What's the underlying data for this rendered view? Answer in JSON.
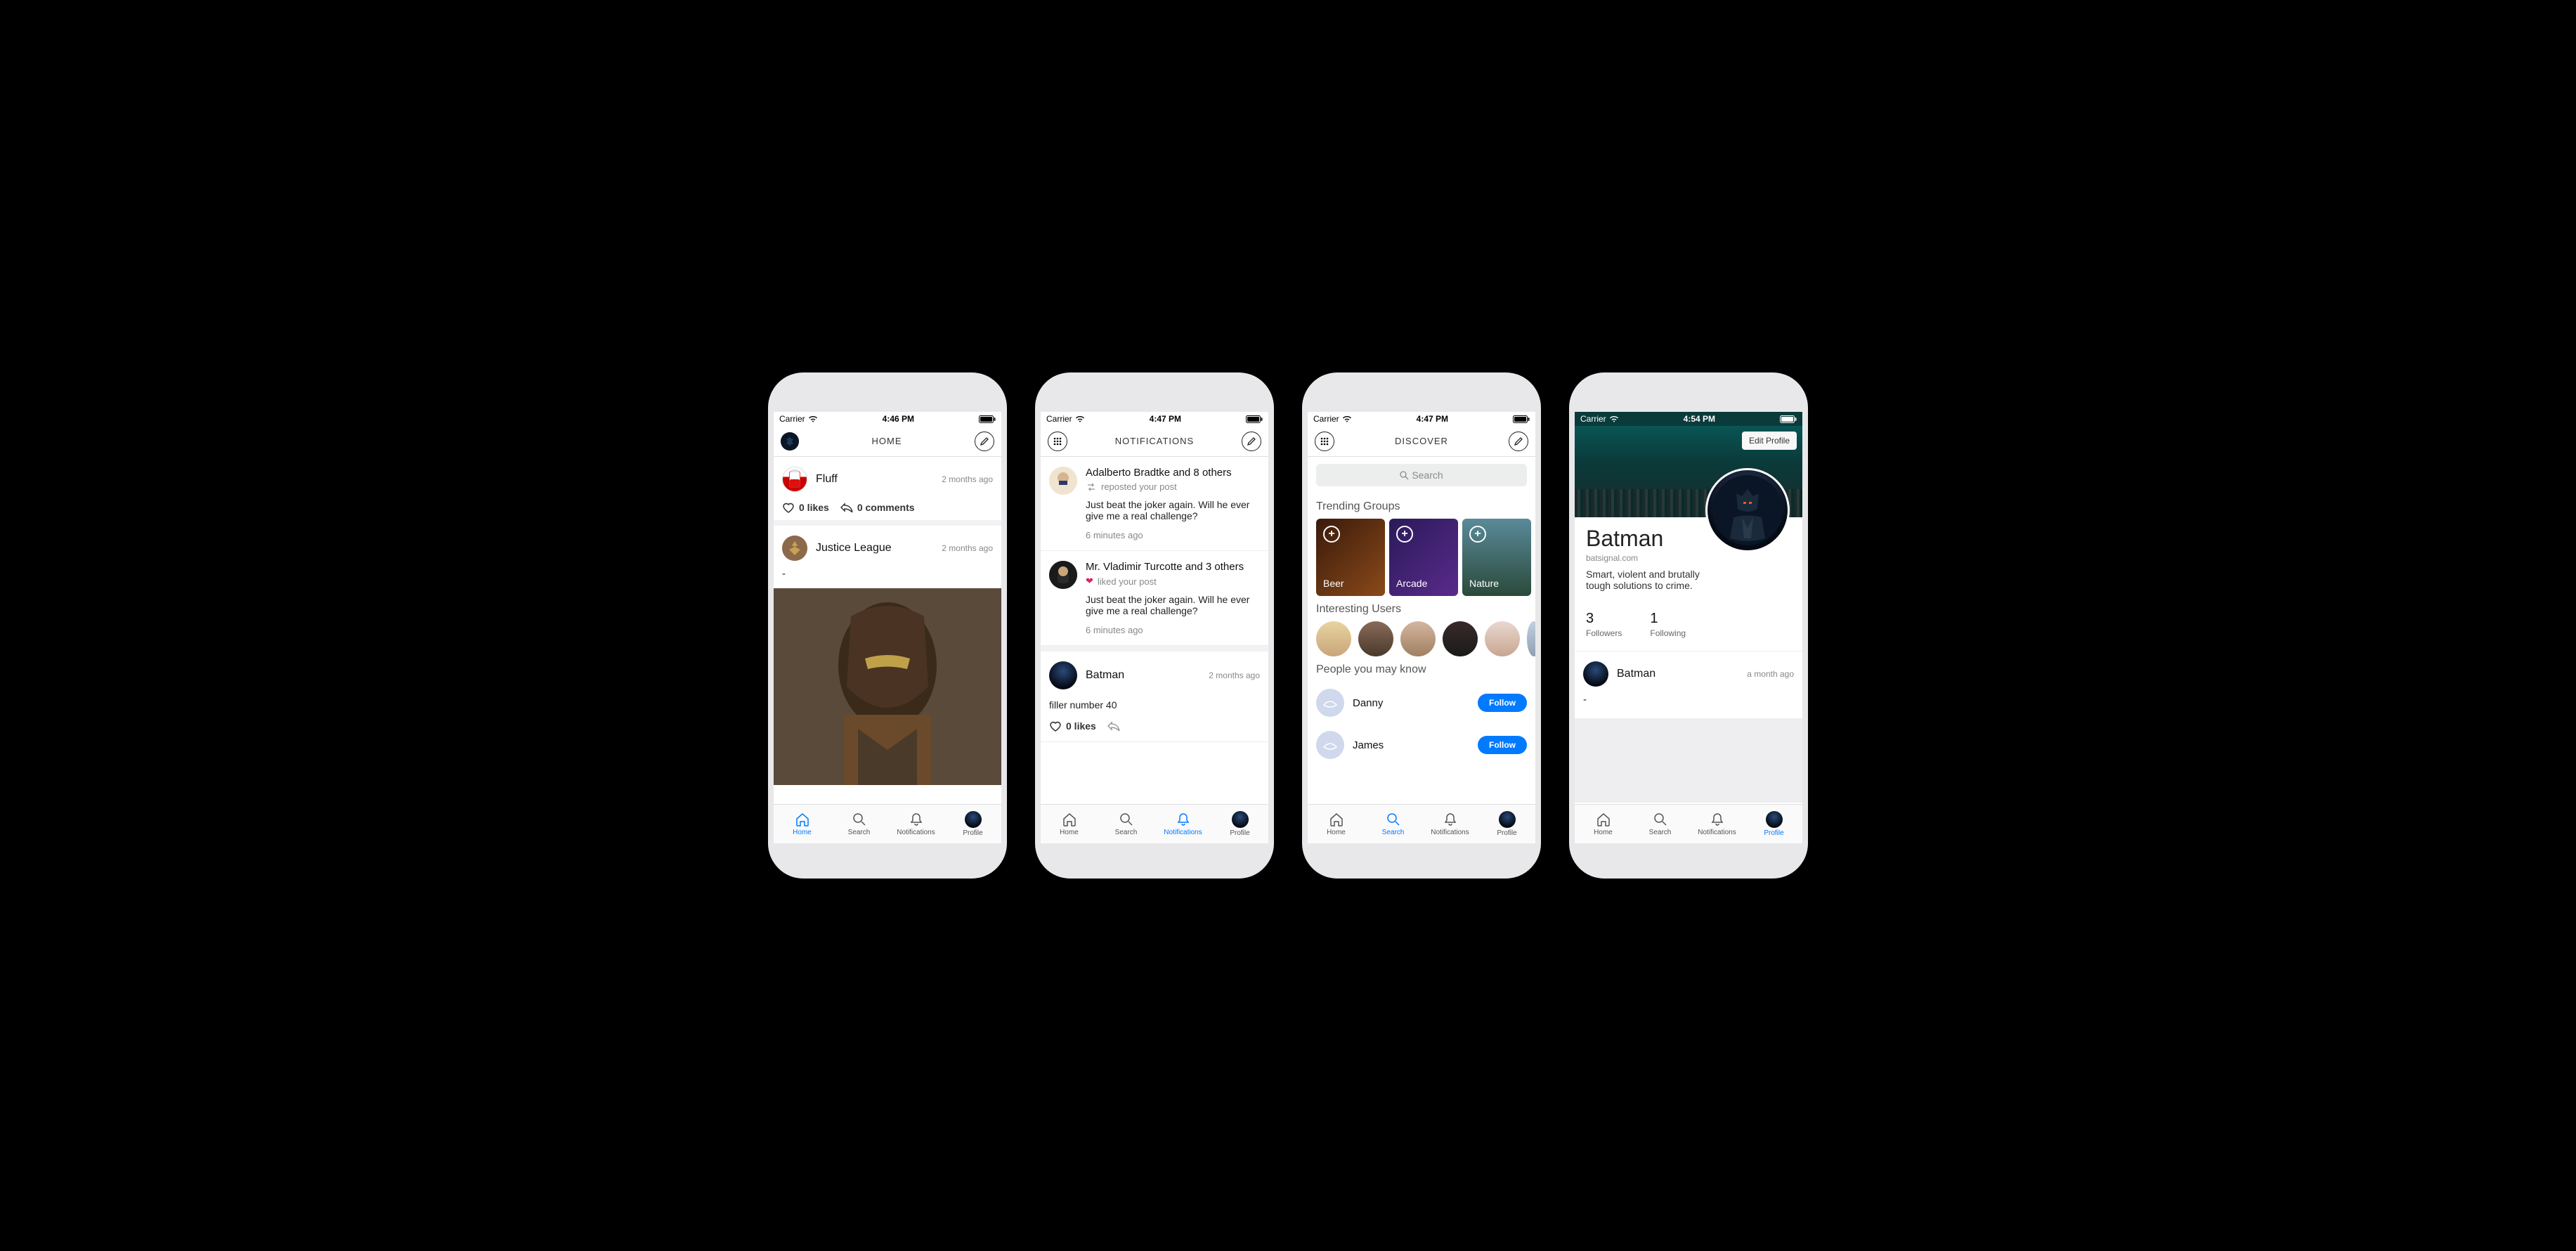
{
  "status": {
    "carrier": "Carrier",
    "times": [
      "4:46 PM",
      "4:47 PM",
      "4:47 PM",
      "4:54 PM"
    ]
  },
  "tabs": {
    "home": "Home",
    "search": "Search",
    "notifications": "Notifications",
    "profile": "Profile"
  },
  "headers": {
    "home": "HOME",
    "notifications": "NOTIFICATIONS",
    "discover": "DISCOVER"
  },
  "home": {
    "posts": [
      {
        "author": "Fluff",
        "time": "2 months ago",
        "likes": "0 likes",
        "comments": "0 comments"
      },
      {
        "author": "Justice League",
        "time": "2 months ago",
        "body": "-"
      }
    ]
  },
  "notifications": {
    "items": [
      {
        "title": "Adalberto Bradtke and 8 others",
        "sub": "reposted your post",
        "text": "Just beat the joker again. Will he ever give me a real challenge?",
        "time": "6 minutes ago"
      },
      {
        "title": "Mr. Vladimir Turcotte and 3 others",
        "sub": "liked your post",
        "text": "Just beat the joker again. Will he ever give me a real challenge?",
        "time": "6 minutes ago"
      }
    ],
    "post": {
      "author": "Batman",
      "time": "2 months ago",
      "body": "filler number 40",
      "likes": "0 likes"
    }
  },
  "discover": {
    "search_placeholder": "Search",
    "trending_title": "Trending Groups",
    "groups": [
      "Beer",
      "Arcade",
      "Nature"
    ],
    "users_title": "Interesting Users",
    "suggest_title": "People you may know",
    "suggestions": [
      {
        "name": "Danny",
        "action": "Follow"
      },
      {
        "name": "James",
        "action": "Follow"
      }
    ]
  },
  "profile": {
    "edit_label": "Edit Profile",
    "name": "Batman",
    "site": "batsignal.com",
    "bio": "Smart, violent and brutally tough solutions to crime.",
    "followers_count": "3",
    "followers_label": "Followers",
    "following_count": "1",
    "following_label": "Following",
    "post": {
      "author": "Batman",
      "time": "a month ago",
      "body": "-"
    }
  }
}
